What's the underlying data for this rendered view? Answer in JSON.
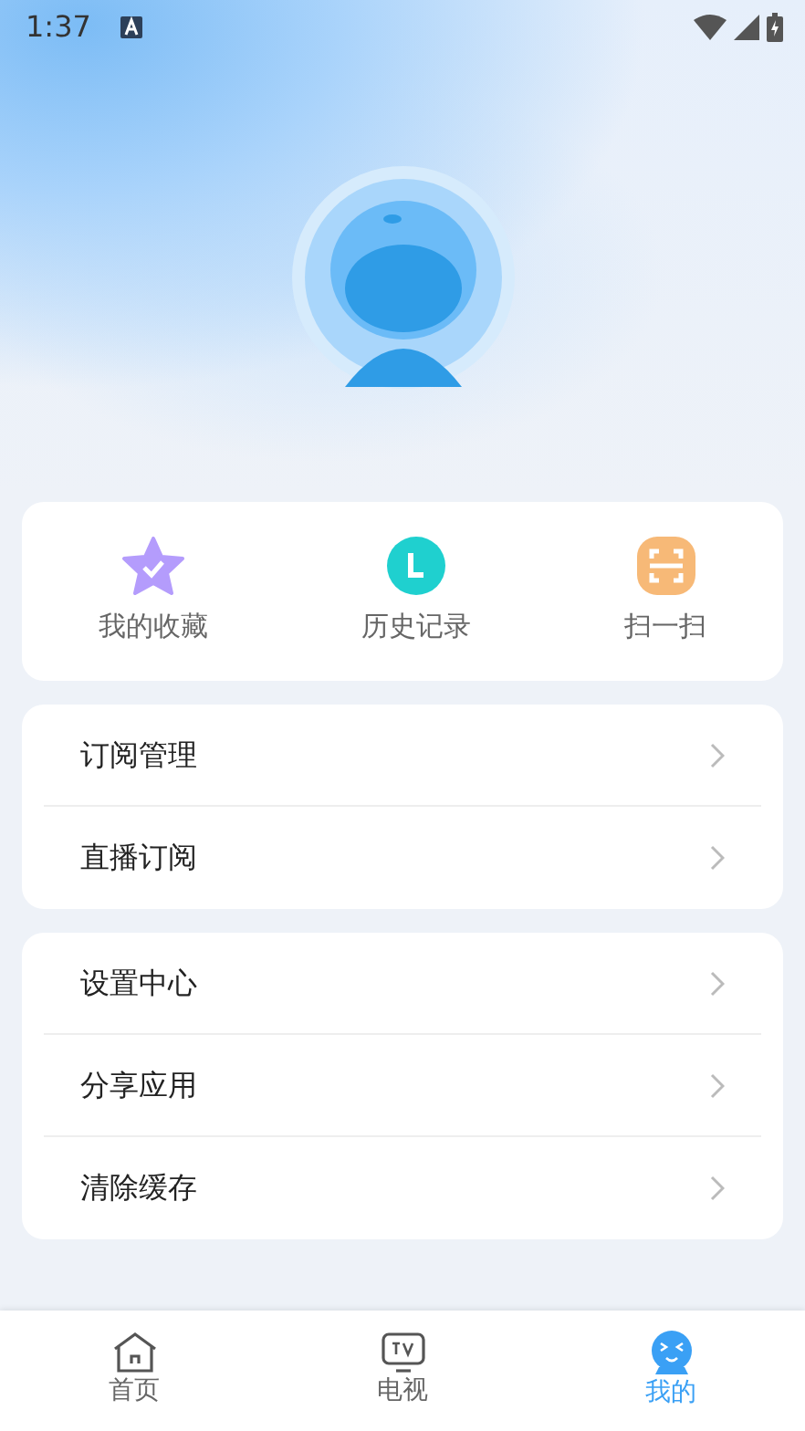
{
  "status_bar": {
    "time": "1:37"
  },
  "quick_actions": [
    {
      "kind": "favorites",
      "label": "我的收藏"
    },
    {
      "kind": "history",
      "label": "历史记录"
    },
    {
      "kind": "scan",
      "label": "扫一扫"
    }
  ],
  "menu_groups": [
    {
      "items": [
        {
          "label": "订阅管理"
        },
        {
          "label": "直播订阅"
        }
      ]
    },
    {
      "items": [
        {
          "label": "设置中心"
        },
        {
          "label": "分享应用"
        },
        {
          "label": "清除缓存"
        }
      ]
    }
  ],
  "tab_bar": [
    {
      "kind": "home",
      "label": "首页",
      "selected": false
    },
    {
      "kind": "tv",
      "label": "电视",
      "selected": false
    },
    {
      "kind": "mine",
      "label": "我的",
      "selected": true
    }
  ]
}
